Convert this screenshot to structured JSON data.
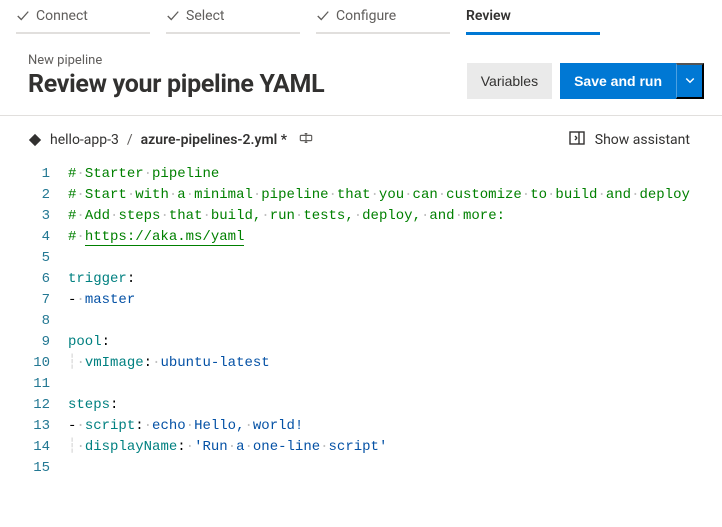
{
  "wizard": {
    "tabs": [
      {
        "label": "Connect",
        "completed": true,
        "active": false
      },
      {
        "label": "Select",
        "completed": true,
        "active": false
      },
      {
        "label": "Configure",
        "completed": true,
        "active": false
      },
      {
        "label": "Review",
        "completed": false,
        "active": true
      }
    ]
  },
  "header": {
    "subtitle": "New pipeline",
    "title": "Review your pipeline YAML",
    "variables_btn": "Variables",
    "save_btn": "Save and run"
  },
  "filebar": {
    "repo": "hello-app-3",
    "separator": "/",
    "filename": "azure-pipelines-2.yml *",
    "assistant": "Show assistant"
  },
  "editor": {
    "lines": [
      {
        "t": "comment",
        "text": "# Starter pipeline"
      },
      {
        "t": "comment",
        "text": "# Start with a minimal pipeline that you can customize to build and deploy"
      },
      {
        "t": "comment",
        "text": "# Add steps that build, run tests, deploy, and more:"
      },
      {
        "t": "comment_link",
        "prefix": "# ",
        "link": "https://aka.ms/yaml"
      },
      {
        "t": "blank"
      },
      {
        "t": "key",
        "key": "trigger"
      },
      {
        "t": "list_str",
        "value": "master"
      },
      {
        "t": "blank"
      },
      {
        "t": "key",
        "key": "pool"
      },
      {
        "t": "kv_indented",
        "key": "vmImage",
        "value": "ubuntu-latest"
      },
      {
        "t": "blank"
      },
      {
        "t": "key",
        "key": "steps"
      },
      {
        "t": "list_kv",
        "key": "script",
        "value": "echo Hello, world!"
      },
      {
        "t": "kv_indented_q",
        "key": "displayName",
        "value": "'Run a one-line script'"
      },
      {
        "t": "blank"
      }
    ]
  }
}
